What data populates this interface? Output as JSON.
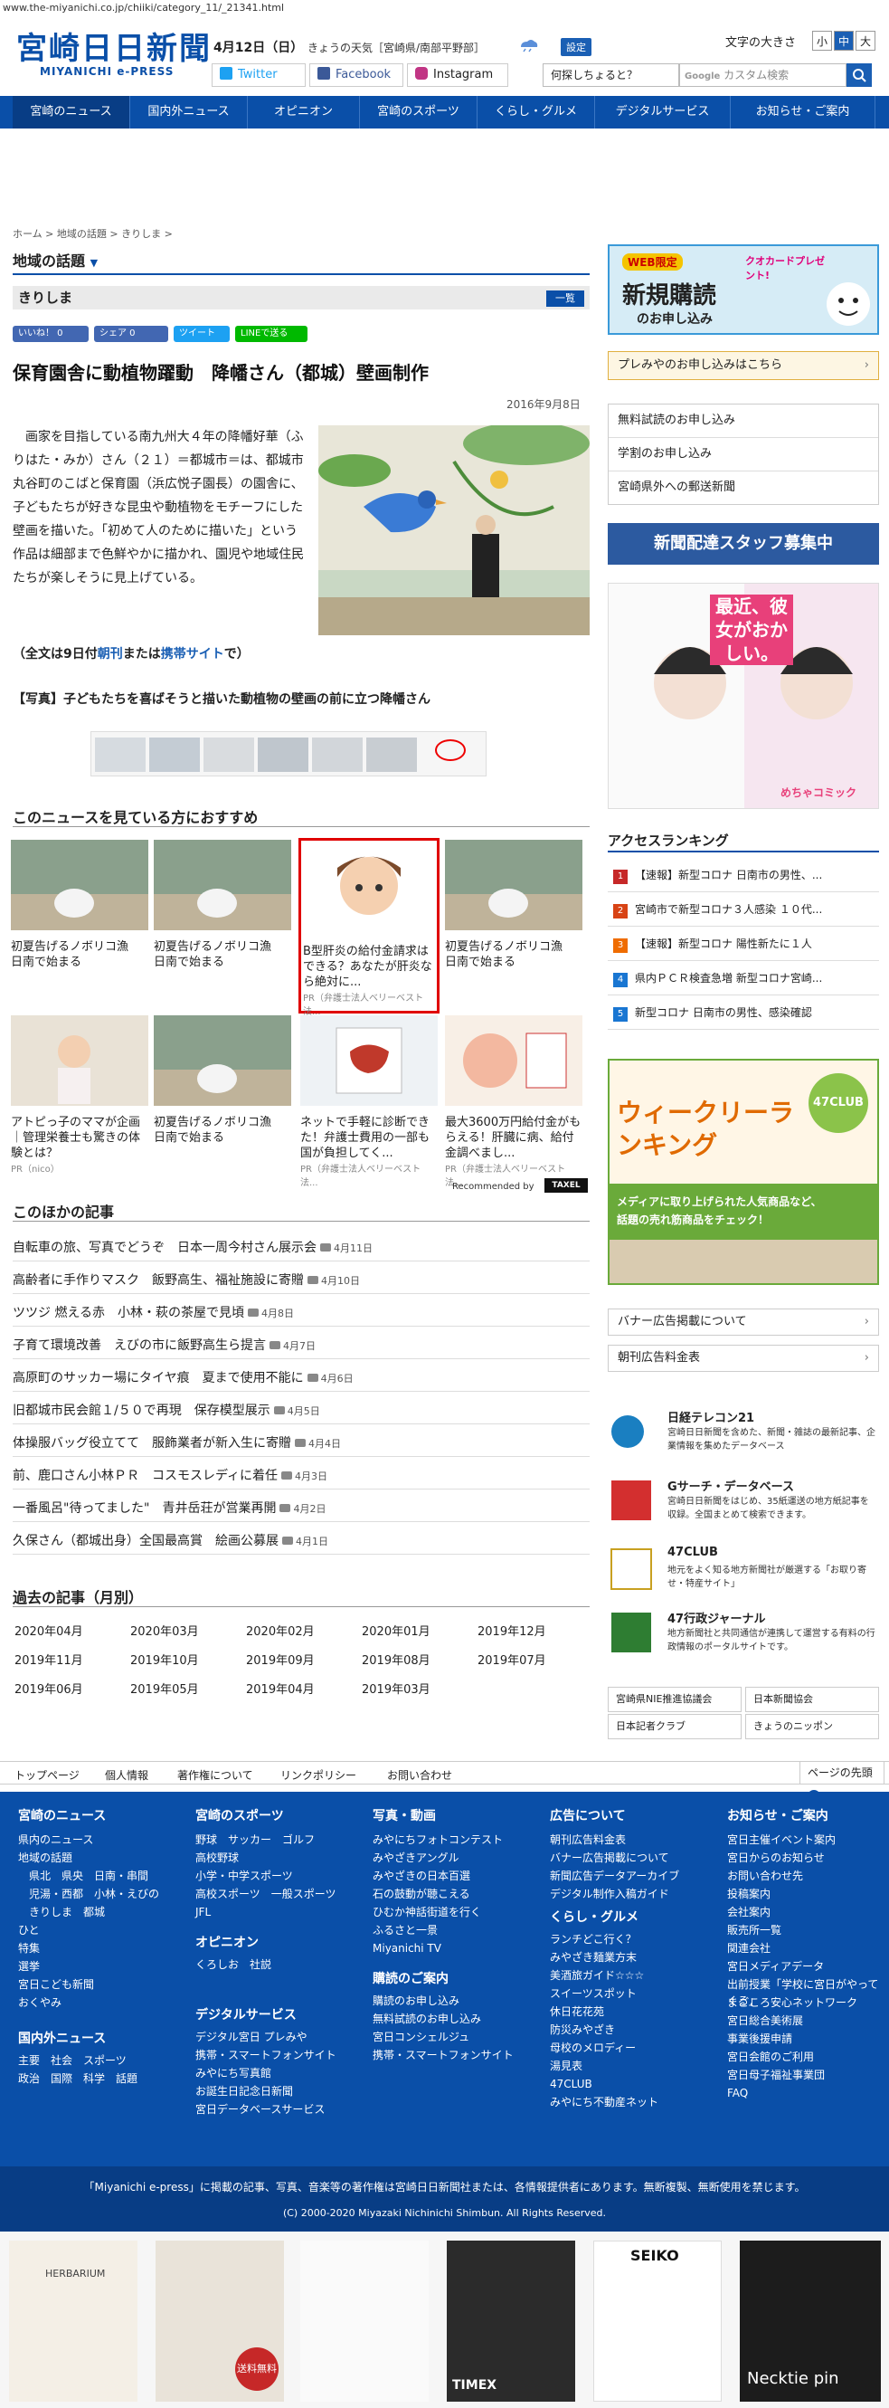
{
  "url": "www.the-miyanichi.co.jp/chiiki/category_11/_21341.html",
  "header": {
    "logo": "宮崎日日新聞",
    "logo_sub": "MIYANICHI e-PRESS",
    "date": "4月12日（日）",
    "weather": "きょうの天気［宮崎県/南部平野部］",
    "settings": "設定",
    "font_size_label": "文字の大きさ",
    "font_small": "小",
    "font_medium": "中",
    "font_large": "大",
    "twitter": "Twitter",
    "facebook": "Facebook",
    "instagram": "Instagram",
    "what_search": "何探しちょると？",
    "search_placeholder": "カスタム検索"
  },
  "nav": [
    "宮崎のニュース",
    "国内外ニュース",
    "オピニオン",
    "宮崎のスポーツ",
    "くらし・グルメ",
    "デジタルサービス",
    "お知らせ・ご案内"
  ],
  "breadcrumb": [
    "ホーム",
    "地域の話題",
    "きりしま"
  ],
  "section_title": "地域の話題",
  "region": "きりしま",
  "list_button": "一覧",
  "share": {
    "like": "いいね！ 0",
    "fb_share": "シェア 0",
    "tweet": "ツイート",
    "line": "LINEで送る"
  },
  "article": {
    "title": "保育園舎に動植物躍動　降幡さん（都城）壁画制作",
    "date": "2016年9月8日",
    "body": "画家を目指している南九州大４年の降幡好華（ふりはた・みか）さん（２１）＝都城市＝は、都城市丸谷町のこばと保育園（浜広悦子園長）の園舎に、子どもたちが好きな昆虫や動植物をモチーフにした壁画を描いた。「初めて人のために描いた」という作品は細部まで色鮮やかに描かれ、園児や地域住民たちが楽しそうに見上げている。",
    "fulltext_pre": "（全文は9日付",
    "fulltext_link1": "朝刊",
    "fulltext_mid": "または",
    "fulltext_link2": "携帯サイト",
    "fulltext_post": "で）",
    "caption": "【写真】子どもたちを喜ばそうと描いた動植物の壁画の前に立つ降幡さん"
  },
  "recommend": {
    "heading": "このニュースを見ている方におすすめ",
    "items": [
      {
        "caption": "初夏告げるノボリコ漁　日南で始まる",
        "pr": ""
      },
      {
        "caption": "初夏告げるノボリコ漁　日南で始まる",
        "pr": ""
      },
      {
        "caption": "B型肝炎の給付金請求はできる？あなたが肝炎なら絶対に...",
        "pr": "PR（弁護士法人ベリーベスト法..."
      },
      {
        "caption": "初夏告げるノボリコ漁　日南で始まる",
        "pr": ""
      },
      {
        "caption": "アトピっ子のママが企画｜管理栄養士も驚きの体験とは？",
        "pr": "PR（nico）"
      },
      {
        "caption": "初夏告げるノボリコ漁　日南で始まる",
        "pr": ""
      },
      {
        "caption": "ネットで手軽に診断できた！弁護士費用の一部も国が負担してく...",
        "pr": "PR（弁護士法人ベリーベスト法..."
      },
      {
        "caption": "最大3600万円給付金がもらえる！肝臓に病、給付金調べまし...",
        "pr": "PR（弁護士法人ベリーベスト法..."
      }
    ],
    "recommended_by": "Recommended by",
    "taxel": "TAXEL"
  },
  "others": {
    "heading": "このほかの記事",
    "items": [
      {
        "title": "自転車の旅、写真でどうぞ　日本一周今村さん展示会",
        "date": "4月11日"
      },
      {
        "title": "高齢者に手作りマスク　飯野高生、福祉施設に寄贈",
        "date": "4月10日"
      },
      {
        "title": "ツツジ 燃える赤　小林・萩の茶屋で見頃",
        "date": "4月8日"
      },
      {
        "title": "子育て環境改善　えびの市に飯野高生ら提言",
        "date": "4月7日"
      },
      {
        "title": "高原町のサッカー場にタイヤ痕　夏まで使用不能に",
        "date": "4月6日"
      },
      {
        "title": "旧都城市民会館１/５０で再現　保存模型展示",
        "date": "4月5日"
      },
      {
        "title": "体操服バッグ役立てて　服飾業者が新入生に寄贈",
        "date": "4月4日"
      },
      {
        "title": "前、鹿口さん小林ＰＲ　コスモスレディに着任",
        "date": "4月3日"
      },
      {
        "title": "一番風呂\"待ってました\"　青井岳荘が営業再開",
        "date": "4月2日"
      },
      {
        "title": "久保さん（都城出身）全国最高賞　絵画公募展",
        "date": "4月1日"
      }
    ]
  },
  "past": {
    "heading": "過去の記事（月別）",
    "months": [
      "2020年04月",
      "2020年03月",
      "2020年02月",
      "2020年01月",
      "2019年12月",
      "2019年11月",
      "2019年10月",
      "2019年09月",
      "2019年08月",
      "2019年07月",
      "2019年06月",
      "2019年05月",
      "2019年04月",
      "2019年03月"
    ]
  },
  "footer_links": [
    "トップページ",
    "個人情報",
    "著作権について",
    "リンクポリシー",
    "お問い合わせ"
  ],
  "page_top": "ページの先頭",
  "footer_nav": [
    {
      "heading": "宮崎のニュース",
      "items": [
        "県内のニュース",
        "地域の話題",
        "　県北　県央　日南・串間",
        "　児湯・西都　小林・えびの",
        "　きりしま　都城",
        "ひと",
        "特集",
        "選挙",
        "宮日こども新聞",
        "おくやみ"
      ]
    },
    {
      "heading": "宮崎のスポーツ",
      "items": [
        "野球　サッカー　ゴルフ",
        "高校野球",
        "小学・中学スポーツ",
        "高校スポーツ　一般スポーツ",
        "JFL"
      ]
    },
    {
      "heading": "写真・動画",
      "items": [
        "みやにちフォトコンテスト",
        "みやざきアングル",
        "みやざきの日本百選",
        "石の鼓動が聴こえる",
        "ひむか神話街道を行く",
        "ふるさと一景",
        "Miyanichi TV"
      ]
    },
    {
      "heading": "広告について",
      "items": [
        "朝刊広告料金表",
        "バナー広告掲載について",
        "新聞広告データアーカイブ",
        "デジタル制作入稿ガイド"
      ]
    },
    {
      "heading": "お知らせ・ご案内",
      "items": [
        "宮日主催イベント案内",
        "宮日からのお知らせ",
        "お問い合わせ先",
        "投稿案内",
        "会社案内",
        "販売所一覧",
        "関連会社",
        "宮日メディアデータ",
        "出前授業「学校に宮日がやってくる」",
        "まごころ安心ネットワーク",
        "宮日総合美術展",
        "事業後援申請",
        "宮日会館のご利用",
        "宮日母子福祉事業団",
        "FAQ"
      ]
    }
  ],
  "footer_nav_extra": [
    {
      "heading": "国内外ニュース",
      "items": [
        "主要　社会　スポーツ",
        "政治　国際　科学　話題"
      ]
    },
    {
      "heading": "オピニオン",
      "items": [
        "くろしお　社説"
      ]
    },
    {
      "heading": "デジタルサービス",
      "items": [
        "デジタル宮日 プレみや",
        "携帯・スマートフォンサイト",
        "みやにち写真館",
        "お誕生日記念日新聞",
        "宮日データベースサービス"
      ]
    },
    {
      "heading": "購読のご案内",
      "items": [
        "購読のお申し込み",
        "無料試読のお申し込み",
        "宮日コンシェルジュ",
        "携帯・スマートフォンサイト"
      ]
    },
    {
      "heading": "くらし・グルメ",
      "items": [
        "ランチどこ行く？",
        "みやざき麺業方末",
        "美酒旅ガイド☆☆☆",
        "スイーツスポット",
        "休日花花苑",
        "防災みやざき",
        "母校のメロディー",
        "湯見表",
        "47CLUB",
        "みやにち不動産ネット"
      ]
    }
  ],
  "copyright": {
    "notice": "「Miyanichi e-press」に掲載の記事、写真、音楽等の著作権は宮崎日日新聞社または、各情報提供者にあります。無断複製、無断使用を禁じます。",
    "line": "(C) 2000-2020 Miyazaki Nichinichi Shimbun. All Rights Reserved."
  },
  "sidebar": {
    "web_only": "WEB限定",
    "quo": "クオカードプレゼント!",
    "new_sub": "新規購読",
    "apply": "のお申し込み",
    "puremiya": "プレみやのお申し込みはこちら",
    "links": [
      "無料試読のお申し込み",
      "学割のお申し込み",
      "宮崎県外への郵送新聞"
    ],
    "staff": "新聞配達スタッフ募集中",
    "manga_title": "最近、彼女がおかしい。",
    "manga_brand": "めちゃコミック",
    "ranking_head": "アクセスランキング",
    "ranking": [
      "【速報】新型コロナ 日南市の男性、...",
      "宮崎市で新型コロナ３人感染 １０代...",
      "【速報】新型コロナ 陽性新たに１人",
      "県内ＰＣＲ検査急増 新型コロナ宮崎...",
      "新型コロナ 日南市の男性、感染確認"
    ],
    "weekly": "ウィークリーランキング",
    "weekly_badge": "47CLUB",
    "weekly_sub1": "メディアに取り上げられた人気商品など、",
    "weekly_sub2": "話題の売れ筋商品をチェック！",
    "ad_links": [
      "バナー広告掲載について",
      "朝刊広告料金表"
    ],
    "media": [
      {
        "title": "日経テレコン21",
        "desc": "宮崎日日新聞を含めた、新聞・雑誌の最新記事、企業情報を集めたデータベース"
      },
      {
        "title": "Gサーチ・データベース",
        "desc": "宮崎日日新聞をはじめ、35紙運送の地方紙記事を収録。全国まとめて検索できます。"
      },
      {
        "title": "47CLUB",
        "desc": "地元をよく知る地方新聞社が厳選する「お取り寄せ・特産サイト」"
      },
      {
        "title": "47行政ジャーナル",
        "desc": "地方新聞社と共同通信が連携して運営する有料の行政情報のポータルサイトです。"
      }
    ],
    "orgs": [
      "宮崎県NIE推進協議会",
      "日本新聞協会",
      "日本記者クラブ",
      "きょうのニッポン"
    ]
  },
  "bottom_ad": {
    "herb": "HERBARIUM",
    "limited": "送料無料",
    "seiko": "SEIKO",
    "timex": "TIMEX",
    "necktie": "Necktie pin"
  },
  "colors": {
    "brand": "#0a4fa8",
    "nav_active": "#083d85",
    "accent": "#e94e1b"
  }
}
